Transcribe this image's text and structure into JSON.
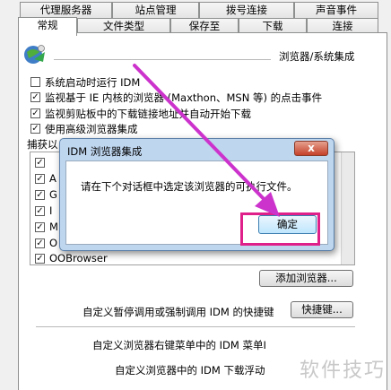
{
  "tabs_row1": [
    "代理服务器",
    "站点管理",
    "拨号连接",
    "声音事件"
  ],
  "tabs_row2": [
    "常规",
    "文件类型",
    "保存至",
    "下载",
    "连接"
  ],
  "section_title": "浏览器/系统集成",
  "options": [
    {
      "label": "系统启动时运行 IDM",
      "checked": false
    },
    {
      "label": "监视基于 IE 内核的浏览器 (Maxthon、MSN 等) 的点击事件",
      "checked": true
    },
    {
      "label": "监视剪贴板中的下载链接地址并自动开始下载",
      "checked": true
    },
    {
      "label": "使用高级浏览器集成",
      "checked": true
    }
  ],
  "capture_label": "捕获以",
  "browser_list_visible": [
    "",
    "A",
    "G",
    "I",
    "M",
    "O",
    "OOBrowser"
  ],
  "add_browser_button": "添加浏览器...",
  "hotkey_label": "自定义暂停调用或强制调用 IDM 的快捷键",
  "hotkey_button": "快捷键...",
  "context_menu_label": "自定义浏览器右键菜单中的 IDM 菜单I",
  "floating_bar_label": "自定义浏览器中的 IDM 下载浮动",
  "popup": {
    "title": "IDM 浏览器集成",
    "close_glyph": "x",
    "message": "请在下个对话框中选定该浏览器的可执行文件。",
    "ok_button": "确定"
  },
  "watermark": "软件技巧",
  "colors": {
    "annotation": "#e0208a",
    "arrow": "#cc33cc"
  }
}
